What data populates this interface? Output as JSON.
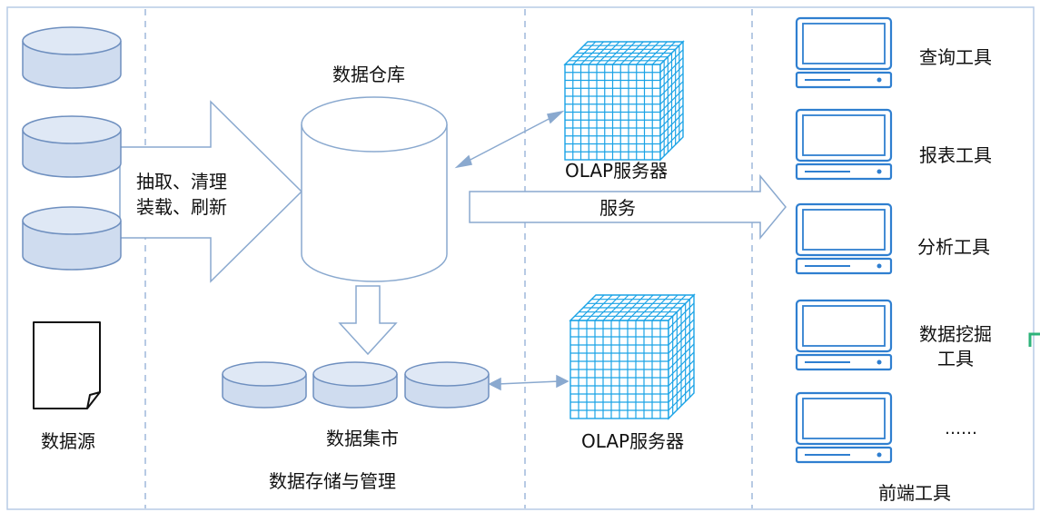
{
  "sections": {
    "source": {
      "label": "数据源"
    },
    "storage": {
      "label": "数据存储与管理",
      "warehouse": "数据仓库",
      "marts": "数据集市",
      "etl_line1": "抽取、清理",
      "etl_line2": "装载、刷新"
    },
    "olap": {
      "server_top": "OLAP服务器",
      "server_bottom": "OLAP服务器",
      "service": "服务"
    },
    "frontend": {
      "label": "前端工具",
      "tools": [
        "查询工具",
        "报表工具",
        "分析工具",
        "数据挖掘",
        "工具",
        "……"
      ]
    }
  },
  "colors": {
    "db_fill": "#cfdcef",
    "db_stroke": "#6e8fbf",
    "cube": "#1aa3e6",
    "monitor": "#2f7fd0",
    "arrow_stroke": "#8aa9cf",
    "divider": "#9fb9dc"
  }
}
